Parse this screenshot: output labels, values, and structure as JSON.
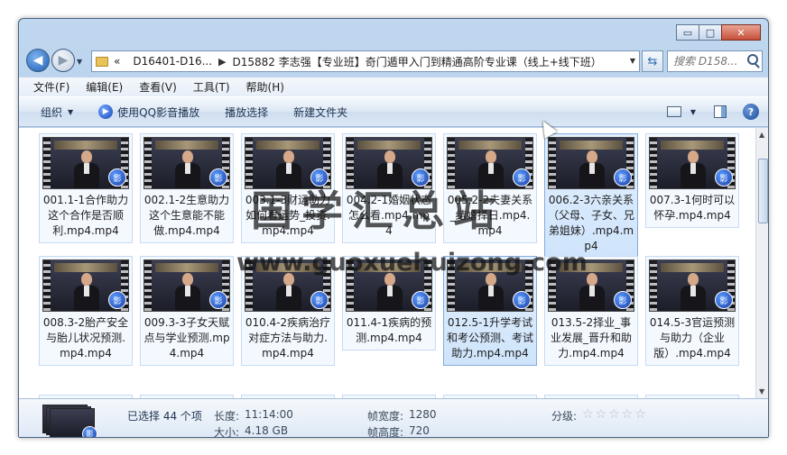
{
  "window": {
    "controls": {
      "minimize": "▭",
      "maximize": "□",
      "close": "✕"
    }
  },
  "address": {
    "back": "◀",
    "forward": "▶",
    "overflow": "«",
    "crumbs": [
      "D16401-D16...",
      "D15882 李志强【专业班】奇门遁甲入门到精通高阶专业课（线上+线下班）"
    ],
    "search_placeholder": "搜索 D158..."
  },
  "menu": [
    "文件(F)",
    "编辑(E)",
    "查看(V)",
    "工具(T)",
    "帮助(H)"
  ],
  "toolbar": {
    "organize": "组织",
    "play_qq": "使用QQ影音播放",
    "play_selection": "播放选择",
    "new_folder": "新建文件夹",
    "help": "?"
  },
  "files": [
    {
      "name": "001.1-1合作助力这个合作是否顺利.mp4.mp4"
    },
    {
      "name": "002.1-2生意助力这个生意能不能做.mp4.mp4"
    },
    {
      "name": "003.1-3财运助力如何看运势_投资.mp4.mp4"
    },
    {
      "name": "004.2-1婚姻状态怎么看.mp4.mp4"
    },
    {
      "name": "005.2-2夫妻关系_结婚择日.mp4.mp4"
    },
    {
      "name": "006.2-3六亲关系（父母、子女、兄弟姐妹）.mp4.mp4"
    },
    {
      "name": "007.3-1何时可以怀孕.mp4.mp4"
    },
    {
      "name": "008.3-2胎产安全与胎儿状况预测.mp4.mp4"
    },
    {
      "name": "009.3-3子女天赋点与学业预测.mp4.mp4"
    },
    {
      "name": "010.4-2疾病治疗对症方法与助力.mp4.mp4"
    },
    {
      "name": "011.4-1疾病的预测.mp4.mp4"
    },
    {
      "name": "012.5-1升学考试和考公预测、考试助力.mp4.mp4"
    },
    {
      "name": "013.5-2择业_事业发展_晋升和助力.mp4.mp4"
    },
    {
      "name": "014.5-3官运预测与助力（企业版）.mp4.mp4"
    }
  ],
  "thumbnail_badge": "影",
  "watermark": {
    "line1": "国学汇总站",
    "line2": "www.guoxuehuizong.com"
  },
  "status": {
    "selected": "已选择 44 个项",
    "length_label": "长度:",
    "length_value": "11:14:00",
    "size_label": "大小:",
    "size_value": "4.18 GB",
    "width_label": "帧宽度:",
    "width_value": "1280",
    "height_label": "帧高度:",
    "height_value": "720",
    "rating_label": "分级:",
    "stars": "☆☆☆☆☆"
  }
}
